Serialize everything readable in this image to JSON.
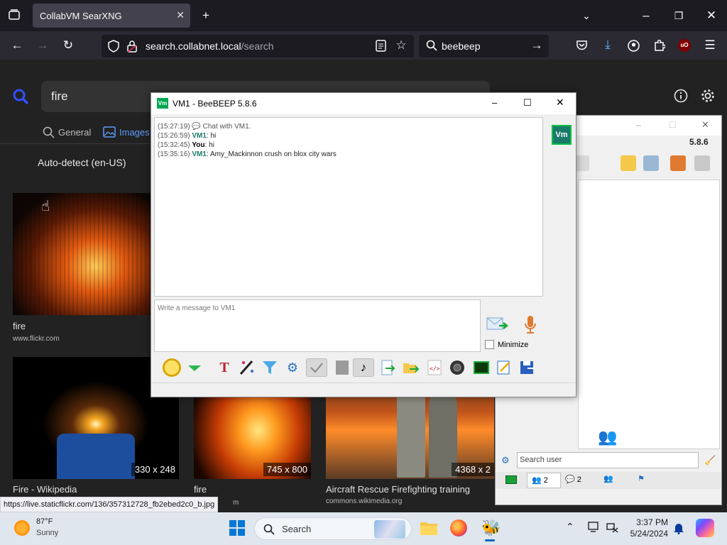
{
  "browser": {
    "tab_title": "CollabVM SearXNG",
    "url_host": "search.collabnet.local",
    "url_path": "/search",
    "search_text": "beebeep",
    "ext_badge": "uO"
  },
  "searx": {
    "query": "fire",
    "tabs": [
      "General",
      "Images"
    ],
    "language": "Auto-detect (en-US)",
    "results": [
      {
        "title": "fire",
        "source": "www.flickr.com",
        "dims": ""
      },
      {
        "title": "Fire - Wikipedia",
        "source": "",
        "dims": "330 x 248"
      },
      {
        "title": "fire",
        "source": "m",
        "dims": "745 x 800"
      },
      {
        "title": "Aircraft Rescue Firefighting training",
        "source": "commons.wikimedia.org",
        "dims": "4368 x 2"
      }
    ],
    "status_url": "https://live.staticflickr.com/136/357312728_fb2ebed2c0_b.jpg"
  },
  "bb_main": {
    "version": "5.8.6",
    "search_placeholder": "Search user",
    "tabs": [
      {
        "count": "2"
      },
      {
        "count": "2"
      }
    ]
  },
  "chat": {
    "title": "VM1 - BeeBEEP 5.8.6",
    "badge": "Vm",
    "messages": [
      {
        "time": "(15:27:19)",
        "who": "",
        "text": "Chat with VM1."
      },
      {
        "time": "(15:26:59)",
        "who": "VM1",
        "text": ": hi"
      },
      {
        "time": "(15:32:45)",
        "who": "You",
        "text": ": hi"
      },
      {
        "time": "(15:35:16)",
        "who": "VM1",
        "text": ": Amy_Mackinnon crush on blox city wars"
      }
    ],
    "input_placeholder": "Write a message to VM1",
    "minimize_label": "Minimize"
  },
  "taskbar": {
    "weather_temp": "87°F",
    "weather_cond": "Sunny",
    "search_label": "Search",
    "time": "3:37 PM",
    "date": "5/24/2024"
  },
  "colors": {
    "accent_blue": "#5b9bf8",
    "vm_green": "#00a651",
    "vm_badge": "#1a7a6a"
  }
}
